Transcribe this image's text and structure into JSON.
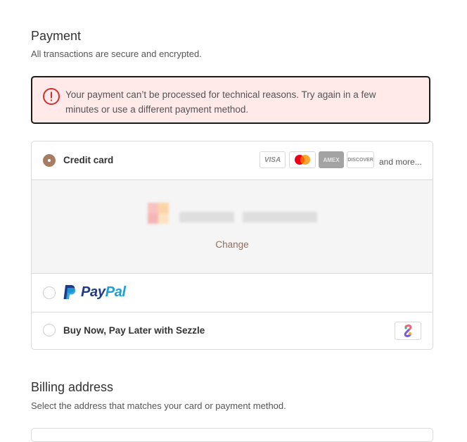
{
  "payment": {
    "title": "Payment",
    "subtitle": "All transactions are secure and encrypted.",
    "error_message": "Your payment can’t be processed for technical reasons. Try again in a few minutes or use a different payment method.",
    "options": [
      {
        "label": "Credit card",
        "selected": true
      },
      {
        "label": "PayPal",
        "selected": false
      },
      {
        "label": "Buy Now, Pay Later with Sezzle",
        "selected": false
      }
    ],
    "card_brands": [
      "VISA",
      "AMEX",
      "DISCOVER"
    ],
    "and_more": "and more...",
    "change_link": "Change",
    "paypal_brand": {
      "pay": "Pay",
      "pal": "Pal"
    }
  },
  "billing": {
    "title": "Billing address",
    "subtitle": "Select the address that matches your card or payment method."
  },
  "colors": {
    "accent": "#a67c62",
    "error_bg": "#ffe9e9",
    "error_red": "#d32f2f",
    "paypal_dark": "#1e3a8a",
    "paypal_light": "#1d9fd8"
  },
  "icons": [
    "error-alert-icon",
    "visa-icon",
    "mastercard-icon",
    "amex-icon",
    "discover-icon",
    "paypal-icon",
    "sezzle-icon"
  ]
}
